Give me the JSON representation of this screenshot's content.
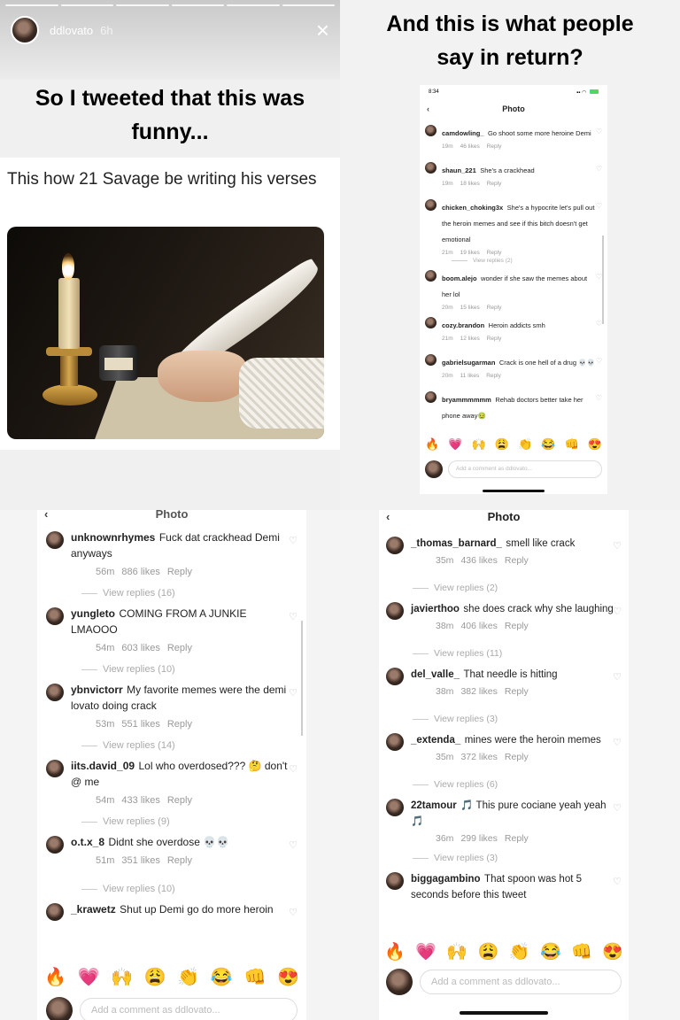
{
  "story": {
    "username": "ddlovato",
    "time": "6h",
    "close_icon": "×",
    "caption_left": "So I tweeted that this was funny...",
    "caption_right": "And this is what people say in return?"
  },
  "tweet": {
    "text": "This how 21 Savage be writing his verses",
    "image_alt": "candle-and-quill-painting"
  },
  "screens": {
    "top_right": {
      "status_time": "8:34",
      "title": "Photo",
      "back_icon": "‹",
      "comments": [
        {
          "user": "camdowling_",
          "text": "Go shoot some more heroine Demi",
          "age": "19m",
          "likes": "46 likes",
          "reply": "Reply"
        },
        {
          "user": "shaun_221",
          "text": "She's a crackhead",
          "age": "19m",
          "likes": "18 likes",
          "reply": "Reply"
        },
        {
          "user": "chicken_choking3x",
          "text": "She's a hypocrite let's pull out the heroin memes and see if this bitch doesn't get emotional",
          "age": "21m",
          "likes": "19 likes",
          "reply": "Reply",
          "view_replies": "View replies (2)"
        },
        {
          "user": "boom.alejo",
          "text": "wonder if she saw the memes about her lol",
          "age": "20m",
          "likes": "15 likes",
          "reply": "Reply"
        },
        {
          "user": "cozy.brandon",
          "text": "Heroin addicts smh",
          "age": "21m",
          "likes": "12 likes",
          "reply": "Reply"
        },
        {
          "user": "gabrielsugarman",
          "text": "Crack is one hell of a drug 💀💀",
          "age": "20m",
          "likes": "11 likes",
          "reply": "Reply"
        },
        {
          "user": "bryammmmmm",
          "text": "Rehab doctors better take her phone away🤢",
          "age": "",
          "likes": "",
          "reply": ""
        }
      ],
      "composer_placeholder": "Add a comment as ddlovato..."
    },
    "bottom_left": {
      "title": "Photo",
      "back_icon": "‹",
      "comments": [
        {
          "user": "unknownrhymes",
          "text": "Fuck dat crackhead Demi anyways",
          "age": "56m",
          "likes": "886 likes",
          "reply": "Reply",
          "view_replies": "View replies (16)"
        },
        {
          "user": "yungleto",
          "text": "COMING FROM A JUNKIE LMAOOO",
          "age": "54m",
          "likes": "603 likes",
          "reply": "Reply",
          "view_replies": "View replies (10)"
        },
        {
          "user": "ybnvictorr",
          "text": "My favorite memes were the demi lovato doing crack",
          "age": "53m",
          "likes": "551 likes",
          "reply": "Reply",
          "view_replies": "View replies (14)"
        },
        {
          "user": "iits.david_09",
          "text": "Lol who overdosed??? 🤔 don't @ me",
          "age": "54m",
          "likes": "433 likes",
          "reply": "Reply",
          "view_replies": "View replies (9)"
        },
        {
          "user": "o.t.x_8",
          "text": "Didnt she overdose 💀💀",
          "age": "51m",
          "likes": "351 likes",
          "reply": "Reply",
          "view_replies": "View replies (10)"
        },
        {
          "user": "_krawetz",
          "text": "Shut up Demi go do more heroin",
          "age": "",
          "likes": "",
          "reply": ""
        }
      ],
      "composer_placeholder": "Add a comment as ddlovato..."
    },
    "bottom_right": {
      "title": "Photo",
      "back_icon": "‹",
      "comments": [
        {
          "user": "_thomas_barnard_",
          "text": "smell like crack",
          "age": "35m",
          "likes": "436 likes",
          "reply": "Reply",
          "view_replies": "View replies (2)"
        },
        {
          "user": "javierthoo",
          "text": "she does crack why she laughing",
          "age": "38m",
          "likes": "406 likes",
          "reply": "Reply",
          "view_replies": "View replies (11)"
        },
        {
          "user": "del_valle_",
          "text": "That needle is hitting",
          "age": "38m",
          "likes": "382 likes",
          "reply": "Reply",
          "view_replies": "View replies (3)"
        },
        {
          "user": "_extenda_",
          "text": "mines were the heroin memes",
          "age": "35m",
          "likes": "372 likes",
          "reply": "Reply",
          "view_replies": "View replies (6)"
        },
        {
          "user": "22tamour",
          "text": "🎵 This pure cociane yeah yeah 🎵",
          "age": "36m",
          "likes": "299 likes",
          "reply": "Reply",
          "view_replies": "View replies (3)"
        },
        {
          "user": "biggagambino",
          "text": "That spoon was hot 5 seconds before this tweet",
          "age": "",
          "likes": "",
          "reply": ""
        }
      ],
      "composer_placeholder": "Add a comment as ddlovato..."
    }
  },
  "emoji_bar": [
    "🔥",
    "💗",
    "🙌",
    "😩",
    "👏",
    "😂",
    "👊",
    "😍"
  ],
  "heart_icon": "♡"
}
